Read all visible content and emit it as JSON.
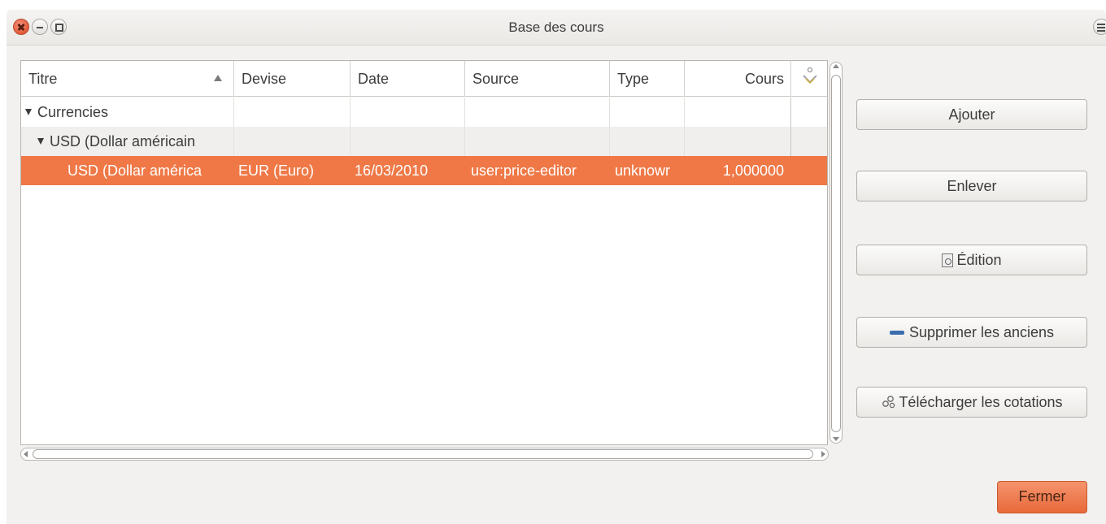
{
  "window": {
    "title": "Base des cours"
  },
  "table": {
    "columns": [
      "Titre",
      "Devise",
      "Date",
      "Source",
      "Type",
      "Cours"
    ],
    "sort_column": "Titre",
    "sort_direction": "ascending",
    "rows": [
      {
        "level": 0,
        "expanded": true,
        "titre": "Currencies",
        "devise": "",
        "date": "",
        "source": "",
        "type": "",
        "cours": ""
      },
      {
        "level": 1,
        "expanded": true,
        "titre": "USD (Dollar américain",
        "devise": "",
        "date": "",
        "source": "",
        "type": "",
        "cours": ""
      },
      {
        "level": 2,
        "selected": true,
        "titre": "USD (Dollar américa",
        "devise": "EUR (Euro)",
        "date": "16/03/2010",
        "source": "user:price-editor",
        "type": "unknowr",
        "cours": "1,000000"
      }
    ]
  },
  "buttons": {
    "ajouter": "Ajouter",
    "enlever": "Enlever",
    "edition": "Édition",
    "supprimer": "Supprimer les anciens",
    "telecharger": "Télécharger les cotations",
    "fermer": "Fermer"
  },
  "colors": {
    "accent": "#ef7846",
    "close_button": "#e35a3a",
    "fermer_button": "#ee7f50"
  }
}
